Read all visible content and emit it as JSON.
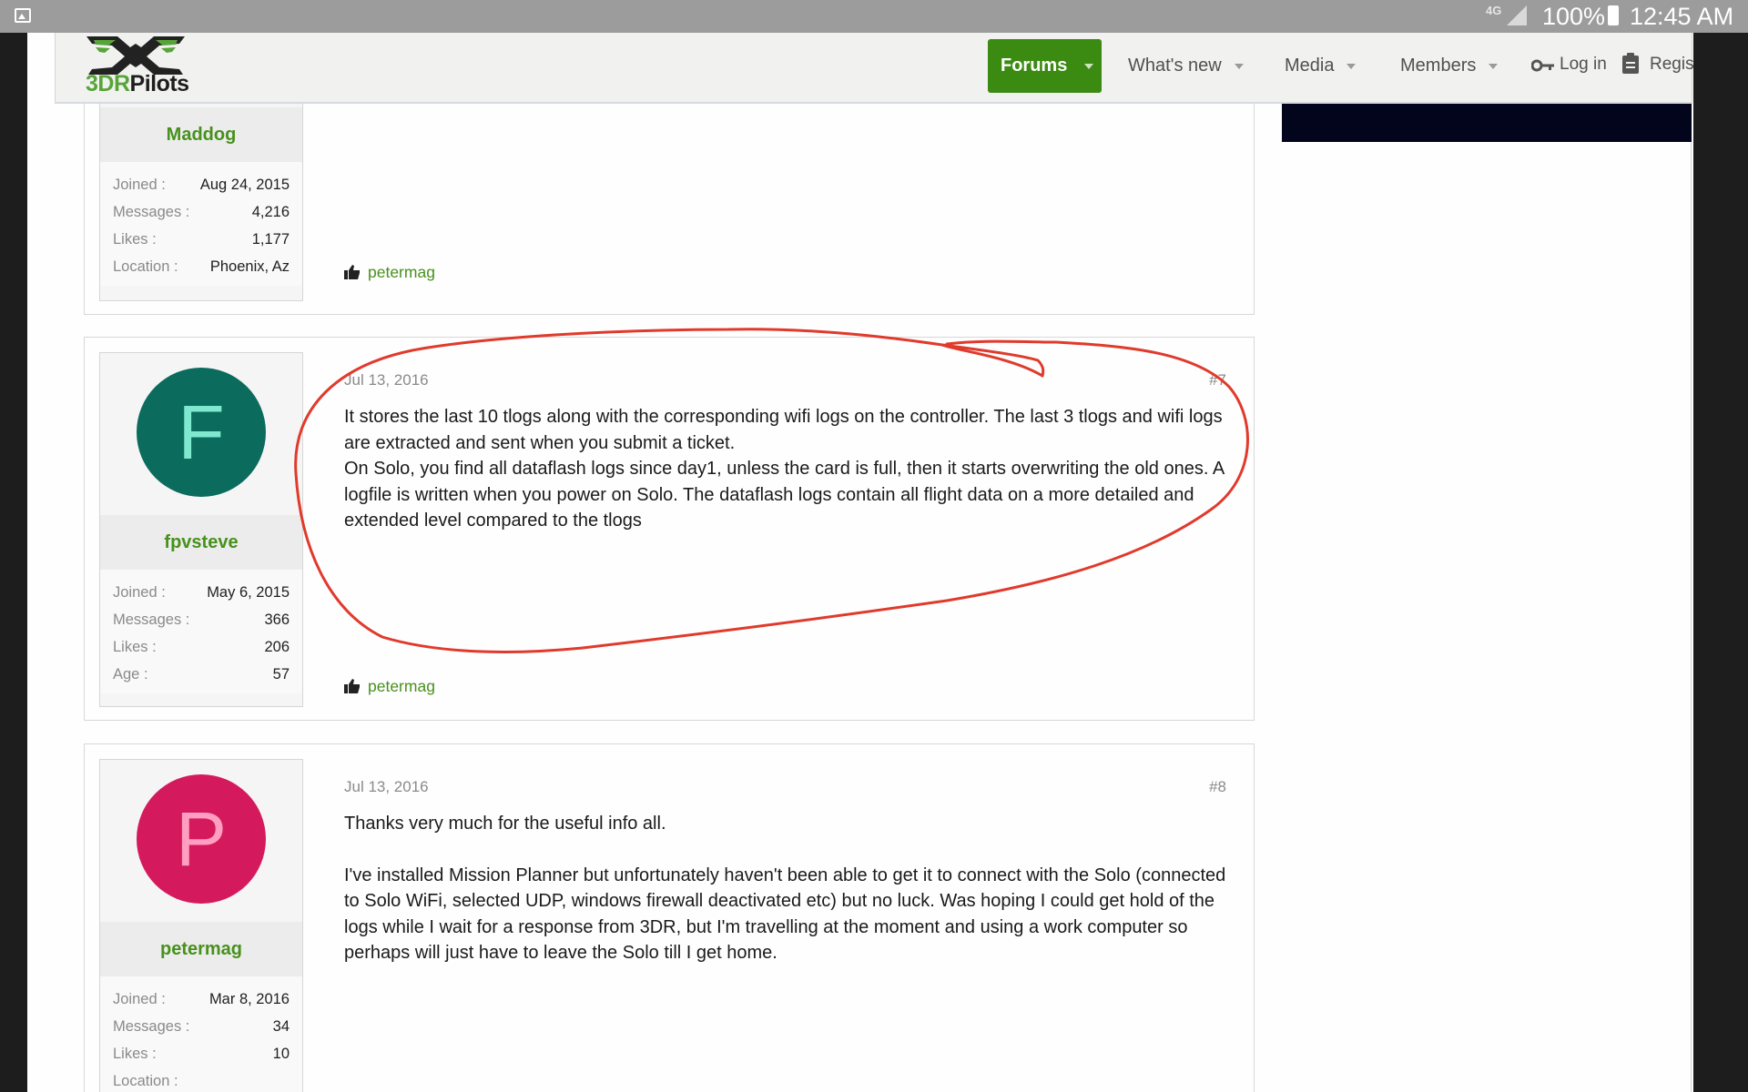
{
  "status_bar": {
    "network": "4G",
    "battery": "100%",
    "time": "12:45 AM"
  },
  "header": {
    "logo_text_prefix": "3DR",
    "logo_text_suffix": "Pilots",
    "nav": {
      "forums": "Forums",
      "whats_new": "What's new",
      "media": "Media",
      "members": "Members",
      "login": "Log in",
      "register": "Register"
    }
  },
  "posts": [
    {
      "username": "Maddog",
      "stats": [
        {
          "label": "Joined :",
          "value": "Aug 24, 2015"
        },
        {
          "label": "Messages :",
          "value": "4,216"
        },
        {
          "label": "Likes :",
          "value": "1,177"
        },
        {
          "label": "Location :",
          "value": "Phoenix, Az"
        }
      ],
      "liked_by": "petermag"
    },
    {
      "avatar_letter": "F",
      "username": "fpvsteve",
      "date": "Jul 13, 2016",
      "post_number": "#7",
      "body": [
        "It stores the last 10 tlogs along with the corresponding wifi logs on the controller. The last 3 tlogs and wifi logs are extracted and sent when you submit a ticket.",
        "On Solo, you find all dataflash logs since day1, unless the card is full, then it starts overwriting the old ones. A logfile is written when you power on Solo. The dataflash logs contain all flight data on a more detailed and extended level compared to the tlogs"
      ],
      "stats": [
        {
          "label": "Joined :",
          "value": "May 6, 2015"
        },
        {
          "label": "Messages :",
          "value": "366"
        },
        {
          "label": "Likes :",
          "value": "206"
        },
        {
          "label": "Age :",
          "value": "57"
        }
      ],
      "liked_by": "petermag"
    },
    {
      "avatar_letter": "P",
      "username": "petermag",
      "date": "Jul 13, 2016",
      "post_number": "#8",
      "body": [
        "Thanks very much for the useful info all.",
        "I've installed Mission Planner but unfortunately haven't been able to get it to connect with the Solo (connected to Solo WiFi, selected UDP, windows firewall deactivated etc) but no luck. Was hoping I could get hold of the logs while I wait for a response from 3DR, but I'm travelling at the moment and using a work computer so perhaps will just have to leave the Solo till I get home."
      ],
      "stats": [
        {
          "label": "Joined :",
          "value": "Mar 8, 2016"
        },
        {
          "label": "Messages :",
          "value": "34"
        },
        {
          "label": "Likes :",
          "value": "10"
        },
        {
          "label": "Location :",
          "value": ""
        }
      ]
    }
  ],
  "colors": {
    "brand_green": "#3b8a12",
    "username_green": "#47911c",
    "avatar_f": "#0b6b5c",
    "avatar_f_letter": "#7fe8cf",
    "avatar_p": "#d41a5c",
    "avatar_p_letter": "#ff9ec0",
    "annotation_red": "#e03a2c"
  }
}
